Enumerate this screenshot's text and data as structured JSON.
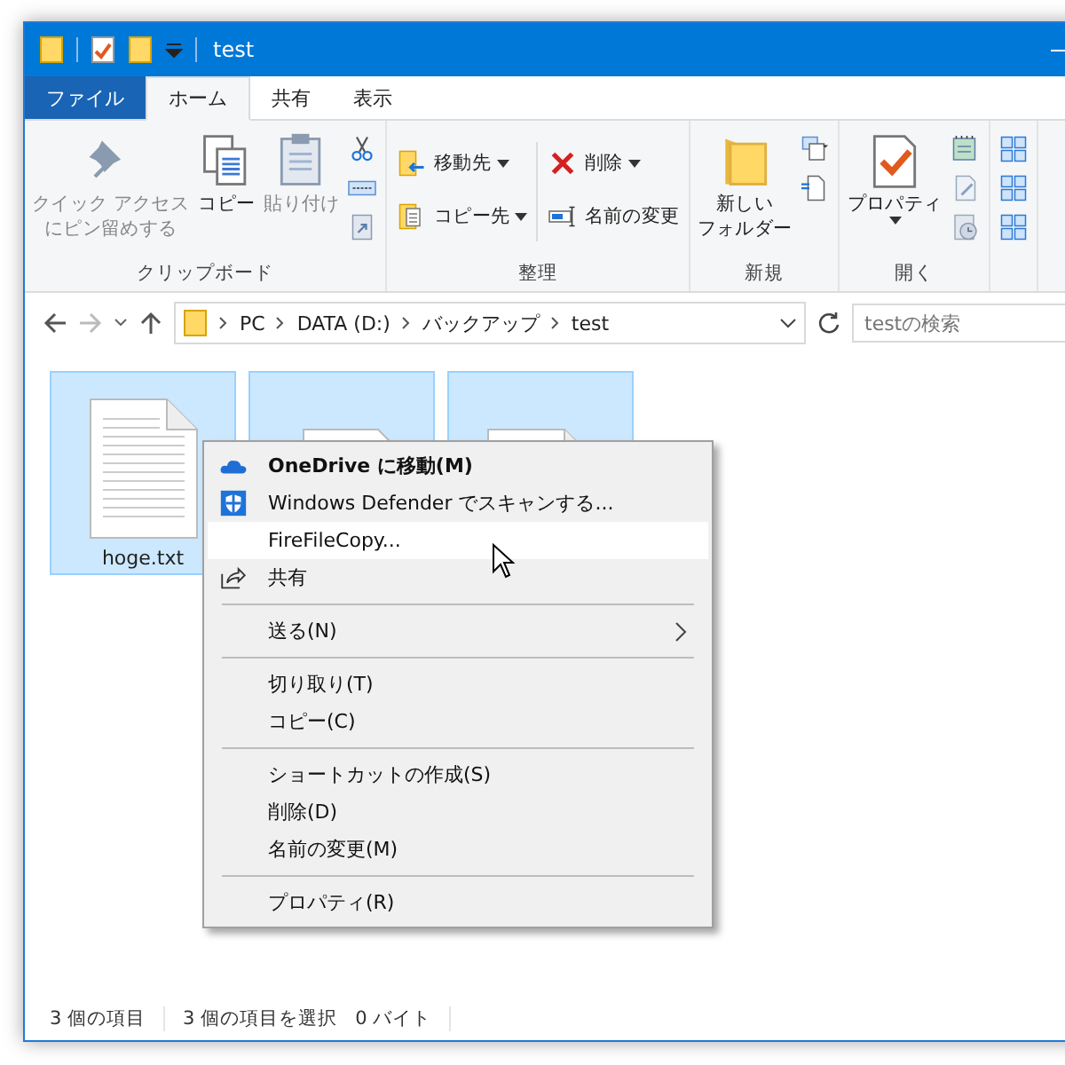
{
  "window": {
    "title": "test"
  },
  "ribbon_tabs": [
    {
      "label": "ファイル",
      "kind": "file",
      "selected": false
    },
    {
      "label": "ホーム",
      "kind": "tab",
      "selected": true
    },
    {
      "label": "共有",
      "kind": "tab",
      "selected": false
    },
    {
      "label": "表示",
      "kind": "tab",
      "selected": false
    }
  ],
  "ribbon_groups": [
    {
      "label": "クリップボード",
      "commands": [
        {
          "kind": "large",
          "lines": [
            "クイック アクセス",
            "にピン留めする"
          ],
          "disabled": true
        },
        {
          "kind": "large",
          "lines": [
            "コピー"
          ],
          "disabled": false
        },
        {
          "kind": "large",
          "lines": [
            "貼り付け"
          ],
          "disabled": true
        },
        {
          "kind": "smallstack"
        }
      ]
    },
    {
      "label": "整理",
      "commands": [
        {
          "kind": "small",
          "label": "移動先",
          "dropdown": true
        },
        {
          "kind": "small",
          "label": "コピー先",
          "dropdown": true
        },
        {
          "kind": "divider"
        },
        {
          "kind": "small",
          "label": "削除",
          "dropdown": true
        },
        {
          "kind": "small",
          "label": "名前の変更",
          "dropdown": false
        }
      ]
    },
    {
      "label": "新規",
      "commands": [
        {
          "kind": "large",
          "lines": [
            "新しい",
            "フォルダー"
          ],
          "disabled": false
        },
        {
          "kind": "smallstack"
        }
      ]
    },
    {
      "label": "開く",
      "commands": [
        {
          "kind": "large",
          "lines": [
            "プロパティ"
          ],
          "disabled": false,
          "dropdown": true
        },
        {
          "kind": "smallstack"
        }
      ]
    },
    {
      "commands": [
        {
          "kind": "smallstack"
        }
      ]
    }
  ],
  "address": {
    "crumbs": [
      "PC",
      "DATA (D:)",
      "バックアップ",
      "test"
    ],
    "search_placeholder": "testの検索"
  },
  "files": [
    {
      "kind": "text",
      "name": "hoge.txt",
      "selected": true
    },
    {
      "kind": "word",
      "selected": true
    },
    {
      "kind": "text",
      "selected": true
    }
  ],
  "context_menu": [
    {
      "kind": "item",
      "label": "OneDrive に移動(M)",
      "bold": true,
      "highlighted": false
    },
    {
      "kind": "item",
      "label": "Windows Defender でスキャンする...",
      "bold": false,
      "highlighted": false
    },
    {
      "kind": "item",
      "label": "FireFileCopy...",
      "bold": false,
      "highlighted": true
    },
    {
      "kind": "item",
      "label": "共有",
      "bold": false,
      "highlighted": false
    },
    {
      "kind": "separator"
    },
    {
      "kind": "submenu",
      "label": "送る(N)",
      "bold": false,
      "highlighted": false
    },
    {
      "kind": "separator"
    },
    {
      "kind": "item",
      "label": "切り取り(T)",
      "bold": false,
      "highlighted": false
    },
    {
      "kind": "item",
      "label": "コピー(C)",
      "bold": false,
      "highlighted": false
    },
    {
      "kind": "separator"
    },
    {
      "kind": "item",
      "label": "ショートカットの作成(S)",
      "bold": false,
      "highlighted": false
    },
    {
      "kind": "item",
      "label": "削除(D)",
      "bold": false,
      "highlighted": false
    },
    {
      "kind": "item",
      "label": "名前の変更(M)",
      "bold": false,
      "highlighted": false
    },
    {
      "kind": "separator"
    },
    {
      "kind": "item",
      "label": "プロパティ(R)",
      "bold": false,
      "highlighted": false
    }
  ],
  "status_bar": [
    "3 個の項目",
    "3 個の項目を選択",
    "0 バイト"
  ]
}
